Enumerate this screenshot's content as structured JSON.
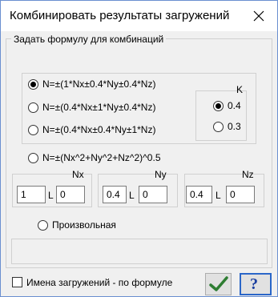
{
  "window": {
    "title": "Комбинировать результаты загружений"
  },
  "group": {
    "legend": "Задать формулу для комбинаций"
  },
  "formulas": [
    {
      "label": "N=±(1*Nx±0.4*Ny±0.4*Nz)",
      "checked": true
    },
    {
      "label": "N=±(0.4*Nx±1*Ny±0.4*Nz)",
      "checked": false
    },
    {
      "label": "N=±(0.4*Nx±0.4*Ny±1*Nz)",
      "checked": false
    },
    {
      "label": "N=±(Nx^2+Ny^2+Nz^2)^0.5",
      "checked": false
    }
  ],
  "k": {
    "label": "K",
    "options": [
      {
        "label": "0.4",
        "checked": true
      },
      {
        "label": "0.3",
        "checked": false
      }
    ]
  },
  "params": [
    {
      "name": "Nx",
      "value": "1",
      "l_label": "L",
      "l_value": "0"
    },
    {
      "name": "Ny",
      "value": "0.4",
      "l_label": "L",
      "l_value": "0"
    },
    {
      "name": "Nz",
      "value": "0.4",
      "l_label": "L",
      "l_value": "0"
    }
  ],
  "arbitrary": {
    "label": "Произвольная",
    "checked": false
  },
  "footer": {
    "checkbox_label": "Имена загружений -   по формуле",
    "checked": false,
    "ok_icon": "checkmark-icon",
    "help_icon": "question-icon",
    "help_label": "?"
  },
  "colors": {
    "window_border": "#6a8fd0",
    "ok_check": "#2e7d32",
    "help_text": "#1a3fa0"
  }
}
